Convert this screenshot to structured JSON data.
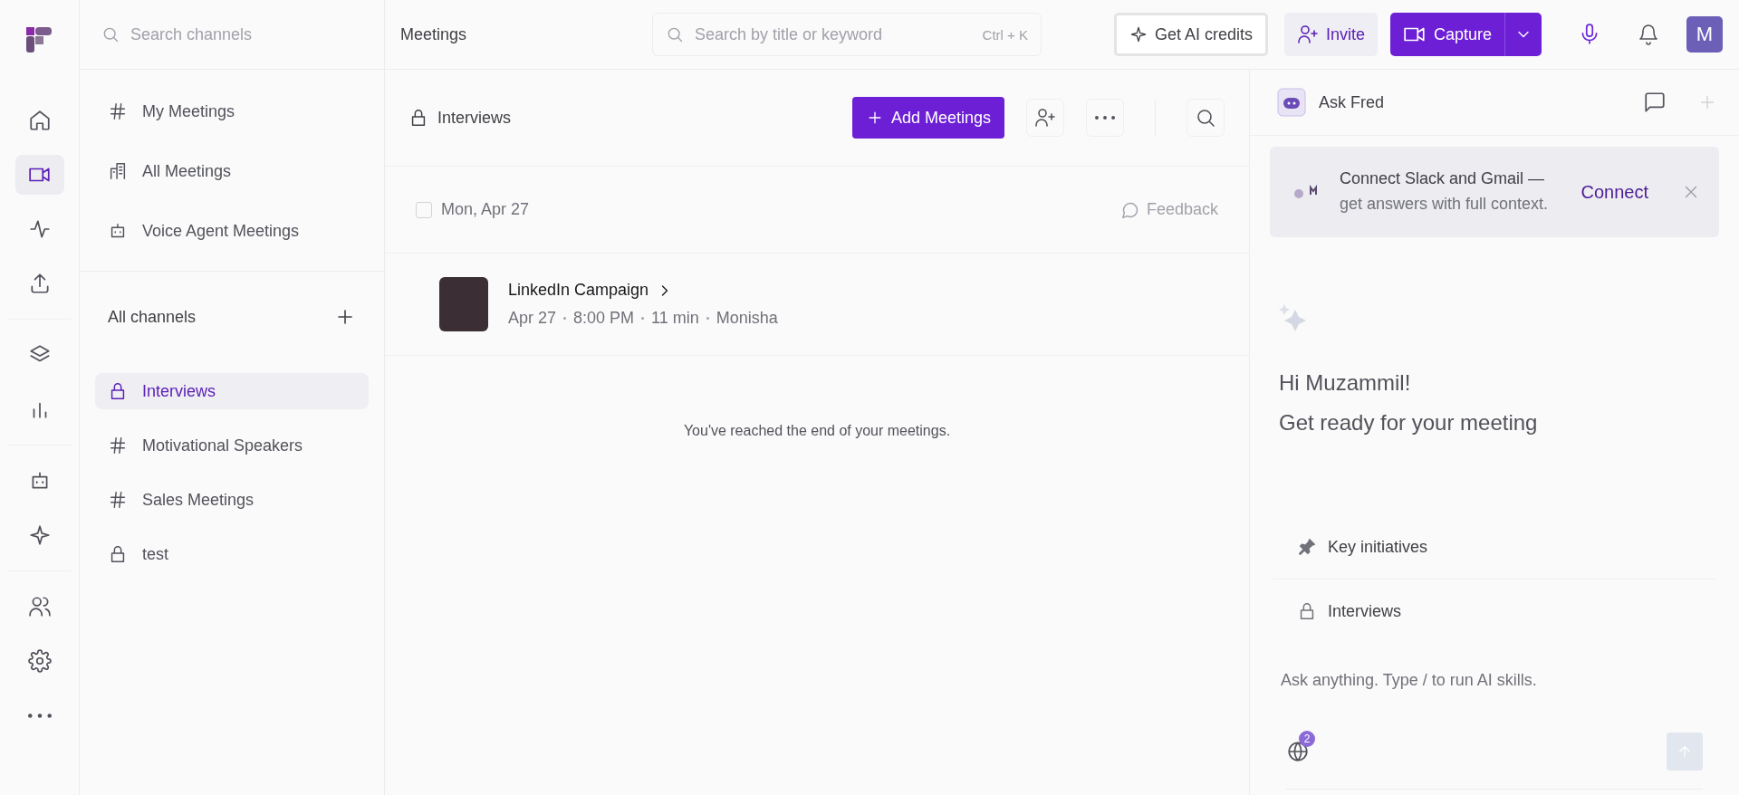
{
  "rail": [
    {
      "items": [
        {
          "kind": "home",
          "selected": false
        },
        {
          "kind": "video",
          "selected": true
        },
        {
          "kind": "activity",
          "selected": false
        },
        {
          "kind": "upload",
          "selected": false
        }
      ]
    },
    {
      "items": [
        {
          "kind": "layers",
          "selected": false
        },
        {
          "kind": "chart",
          "selected": false
        }
      ]
    },
    {
      "items": [
        {
          "kind": "bot",
          "selected": false
        },
        {
          "kind": "sparkle",
          "selected": false
        }
      ]
    },
    {
      "items": [
        {
          "kind": "users",
          "selected": false
        },
        {
          "kind": "settings",
          "selected": false
        },
        {
          "kind": "more",
          "selected": false
        }
      ]
    }
  ],
  "channel_search": {
    "placeholder": "Search channels"
  },
  "nav": [
    {
      "kind": "hash",
      "label": "My Meetings"
    },
    {
      "kind": "building",
      "label": "All Meetings"
    },
    {
      "kind": "bot",
      "label": "Voice Agent Meetings"
    }
  ],
  "channels": {
    "title": "All channels",
    "items": [
      {
        "kind": "lock",
        "label": "Interviews",
        "selected": true
      },
      {
        "kind": "hash",
        "label": "Motivational Speakers",
        "selected": false
      },
      {
        "kind": "hash",
        "label": "Sales Meetings",
        "selected": false
      },
      {
        "kind": "lock",
        "label": "test",
        "selected": false
      }
    ]
  },
  "header": {
    "title": "Meetings",
    "search": {
      "placeholder": "Search by title or keyword",
      "shortcut": "Ctrl + K"
    },
    "credits_button": "Get AI credits",
    "invite_button": "Invite",
    "capture_button": "Capture",
    "avatar": "M"
  },
  "channel_header": {
    "title": "Interviews",
    "add_button": "Add Meetings"
  },
  "date_group": {
    "date": "Mon, Apr 27",
    "checked": false,
    "feedback": "Feedback"
  },
  "meetings": [
    {
      "title": "LinkedIn Campaign",
      "date": "Apr 27",
      "time": "8:00 PM",
      "duration": "11 min",
      "owner": "Monisha"
    }
  ],
  "end_message": "You've reached the end of your meetings.",
  "assistant": {
    "title": "Ask Fred",
    "banner": {
      "title": "Connect Slack and Gmail —",
      "text": "get answers with full context.",
      "action": "Connect"
    },
    "greeting": "Hi Muzammil!",
    "subtitle": "Get ready for your meeting",
    "context": [
      {
        "kind": "pin",
        "label": "Key initiatives"
      },
      {
        "kind": "lock",
        "label": "Interviews"
      }
    ],
    "input": {
      "placeholder": "Ask anything. Type / to run AI skills."
    },
    "sources_count": "2"
  }
}
